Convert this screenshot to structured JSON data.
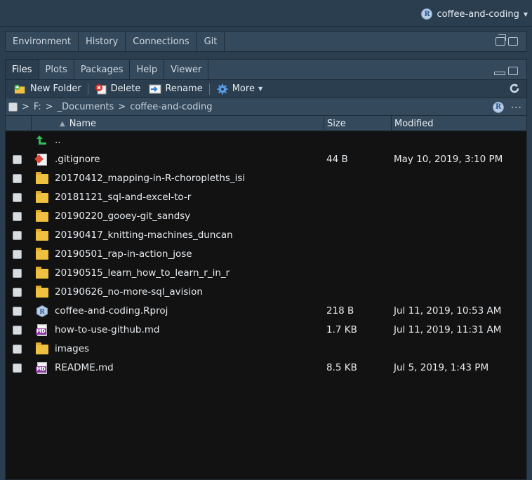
{
  "project": {
    "name": "coffee-and-coding"
  },
  "upper_tabs": [
    "Environment",
    "History",
    "Connections",
    "Git"
  ],
  "lower_tabs": [
    "Files",
    "Plots",
    "Packages",
    "Help",
    "Viewer"
  ],
  "toolbar": {
    "new_folder": "New Folder",
    "delete": "Delete",
    "rename": "Rename",
    "more": "More"
  },
  "path": [
    "F:",
    "_Documents",
    "coffee-and-coding"
  ],
  "columns": {
    "name": "Name",
    "size": "Size",
    "modified": "Modified"
  },
  "parent_label": "..",
  "files": [
    {
      "name": ".gitignore",
      "icon": "gitignore-icon",
      "size": "44 B",
      "modified": "May 10, 2019, 3:10 PM"
    },
    {
      "name": "20170412_mapping-in-R-choropleths_isi",
      "icon": "folder-icon",
      "size": "",
      "modified": ""
    },
    {
      "name": "20181121_sql-and-excel-to-r",
      "icon": "folder-icon",
      "size": "",
      "modified": ""
    },
    {
      "name": "20190220_gooey-git_sandsy",
      "icon": "folder-icon",
      "size": "",
      "modified": ""
    },
    {
      "name": "20190417_knitting-machines_duncan",
      "icon": "folder-icon",
      "size": "",
      "modified": ""
    },
    {
      "name": "20190501_rap-in-action_jose",
      "icon": "folder-icon",
      "size": "",
      "modified": ""
    },
    {
      "name": "20190515_learn_how_to_learn_r_in_r",
      "icon": "folder-icon",
      "size": "",
      "modified": ""
    },
    {
      "name": "20190626_no-more-sql_avision",
      "icon": "folder-icon",
      "size": "",
      "modified": ""
    },
    {
      "name": "coffee-and-coding.Rproj",
      "icon": "rproj-icon",
      "size": "218 B",
      "modified": "Jul 11, 2019, 10:53 AM"
    },
    {
      "name": "how-to-use-github.md",
      "icon": "markdown-icon",
      "size": "1.7 KB",
      "modified": "Jul 11, 2019, 11:31 AM"
    },
    {
      "name": "images",
      "icon": "folder-icon",
      "size": "",
      "modified": ""
    },
    {
      "name": "README.md",
      "icon": "markdown-icon",
      "size": "8.5 KB",
      "modified": "Jul 5, 2019, 1:43 PM"
    }
  ]
}
